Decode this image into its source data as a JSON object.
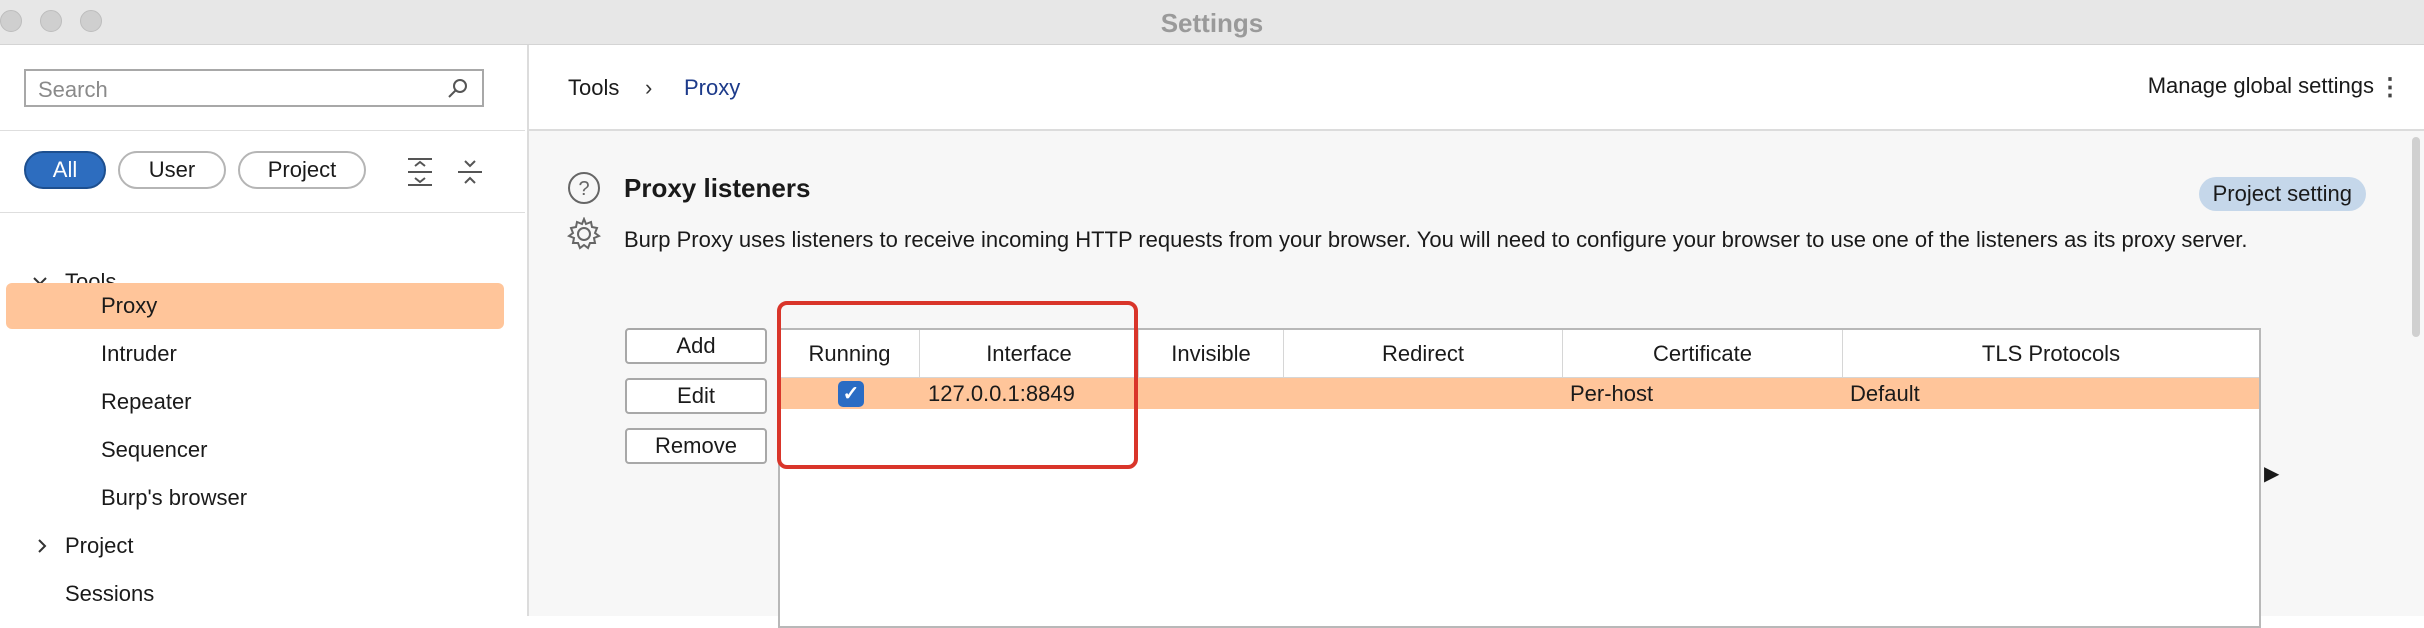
{
  "window": {
    "title": "Settings"
  },
  "sidebar": {
    "search_placeholder": "Search",
    "filters": [
      "All",
      "User",
      "Project"
    ],
    "active_filter": "All",
    "tree": [
      {
        "label": "Tools",
        "expanded": true
      },
      {
        "label": "Proxy",
        "selected": true
      },
      {
        "label": "Intruder"
      },
      {
        "label": "Repeater"
      },
      {
        "label": "Sequencer"
      },
      {
        "label": "Burp's browser"
      },
      {
        "label": "Project",
        "expanded": false
      },
      {
        "label": "Sessions"
      }
    ]
  },
  "header": {
    "breadcrumb": [
      "Tools",
      "Proxy"
    ],
    "manage_label": "Manage global settings"
  },
  "section": {
    "title": "Proxy listeners",
    "badge": "Project setting",
    "description": "Burp Proxy uses listeners to receive incoming HTTP requests from your browser. You will need to configure your browser to use one of the listeners as its proxy server.",
    "buttons": {
      "add": "Add",
      "edit": "Edit",
      "remove": "Remove"
    }
  },
  "table": {
    "columns": [
      "Running",
      "Interface",
      "Invisible",
      "Redirect",
      "Certificate",
      "TLS Protocols"
    ],
    "rows": [
      {
        "running": true,
        "interface": "127.0.0.1:8849",
        "invisible": "",
        "redirect": "",
        "certificate": "Per-host",
        "tls": "Default"
      }
    ]
  },
  "colors": {
    "selected_row": "#ffc59a",
    "active_pill": "#2d6dbf",
    "highlight_border": "#d9352a",
    "badge_bg": "#c5d7ea"
  }
}
